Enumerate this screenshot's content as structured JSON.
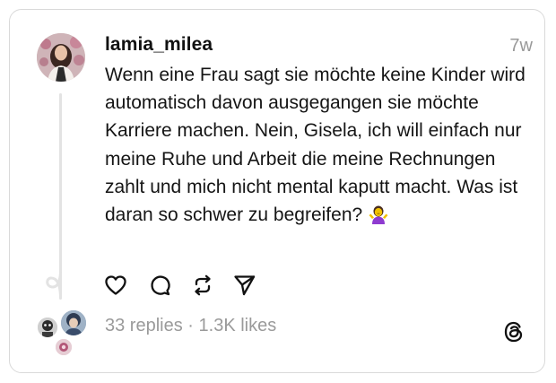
{
  "post": {
    "username": "lamia_milea",
    "timestamp": "7w",
    "text": "Wenn eine Frau sagt sie möchte keine Kinder wird automatisch davon ausgegangen sie möchte Karriere machen. Nein, Gisela, ich will einfach nur meine Ruhe und Arbeit die meine Rechnungen zahlt und mich nicht mental kaputt macht. Was ist daran so schwer zu begreifen?",
    "emoji": "person-shrugging-emoji"
  },
  "actions": {
    "like_icon": "heart-icon",
    "comment_icon": "speech-bubble-icon",
    "repost_icon": "repost-arrows-icon",
    "share_icon": "send-paper-plane-icon"
  },
  "stats": {
    "replies": "33 replies",
    "separator": "·",
    "likes": "1.3K likes"
  },
  "brand": {
    "logo_icon": "threads-logo-icon"
  },
  "colors": {
    "text": "#111111",
    "muted": "#999999",
    "border": "#d9d9d9",
    "shrug_emoji": "#8e3bd0"
  }
}
